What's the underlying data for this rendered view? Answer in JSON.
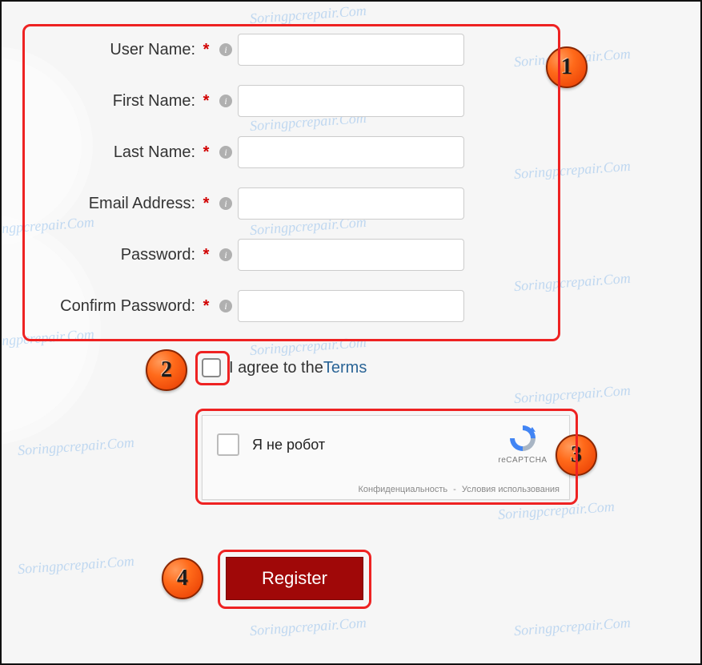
{
  "watermark": "Soringpcrepair.Com",
  "form": {
    "fields": [
      {
        "label": "User Name:"
      },
      {
        "label": "First Name:"
      },
      {
        "label": "Last Name:"
      },
      {
        "label": "Email Address:"
      },
      {
        "label": "Password:"
      },
      {
        "label": "Confirm Password:"
      }
    ]
  },
  "terms": {
    "text": "I agree to the ",
    "link": "Terms"
  },
  "captcha": {
    "label": "Я не робот",
    "brand": "reCAPTCHA",
    "privacy": "Конфиденциальность",
    "separator": " - ",
    "terms": "Условия использования"
  },
  "register": {
    "label": "Register"
  },
  "badges": [
    "1",
    "2",
    "3",
    "4"
  ]
}
